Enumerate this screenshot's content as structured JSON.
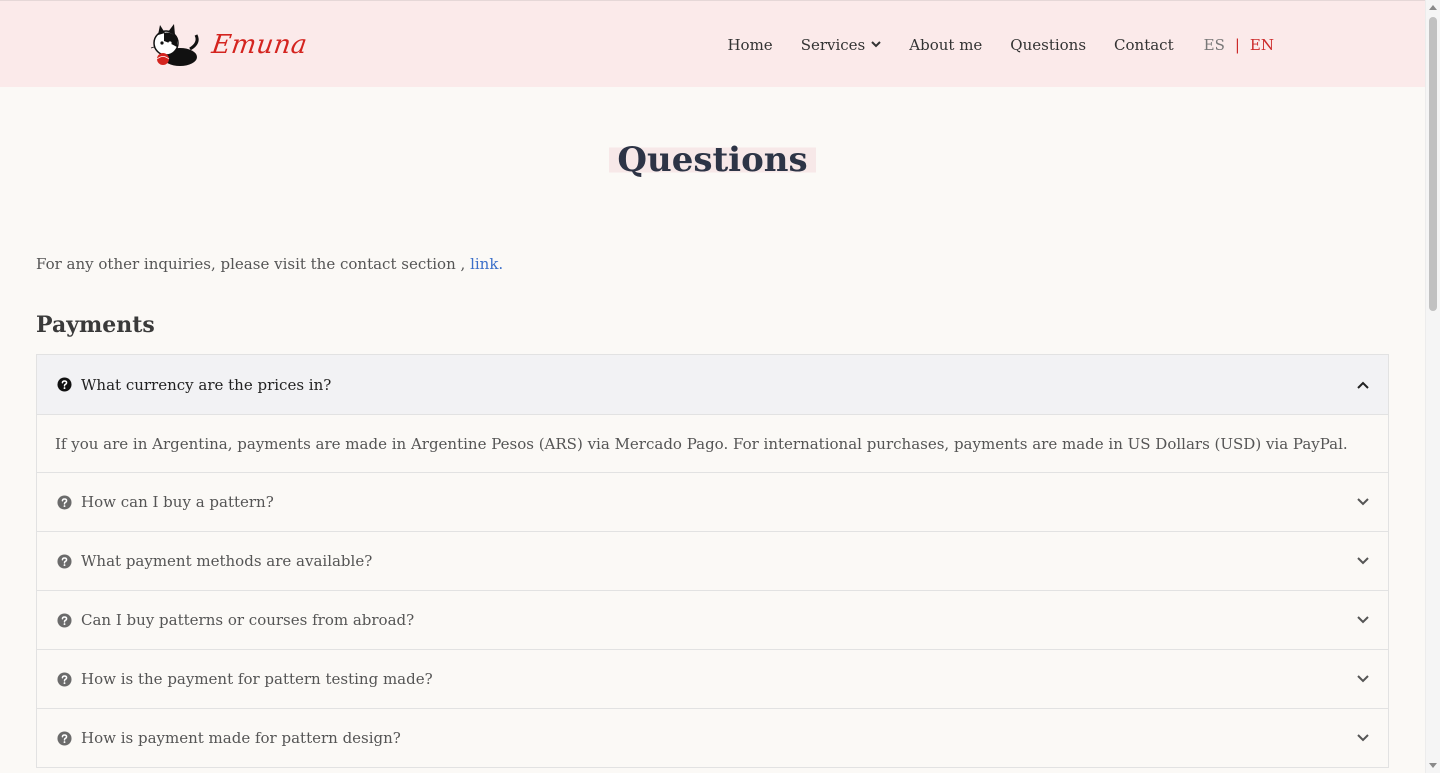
{
  "header": {
    "logo_text": "Emuna",
    "nav": [
      {
        "label": "Home"
      },
      {
        "label": "Services",
        "has_dropdown": true
      },
      {
        "label": "About me"
      },
      {
        "label": "Questions"
      },
      {
        "label": "Contact"
      }
    ],
    "lang": {
      "es": "ES",
      "separator": "|",
      "en": "EN",
      "active": "EN"
    }
  },
  "main": {
    "title": "Questions",
    "intro_text": "For any other inquiries, please visit the contact section , ",
    "intro_link": "link.",
    "section_title": "Payments",
    "faq": [
      {
        "question": "What currency are the prices in?",
        "open": true,
        "answer": "If you are in Argentina, payments are made in Argentine Pesos (ARS) via Mercado Pago. For international purchases, payments are made in US Dollars (USD) via PayPal."
      },
      {
        "question": "How can I buy a pattern?",
        "open": false
      },
      {
        "question": "What payment methods are available?",
        "open": false
      },
      {
        "question": "Can I buy patterns or courses from abroad?",
        "open": false
      },
      {
        "question": "How is the payment for pattern testing made?",
        "open": false
      },
      {
        "question": "How is payment made for pattern design?",
        "open": false
      }
    ]
  },
  "colors": {
    "header_bg": "#fbeaea",
    "page_bg": "#fbf9f6",
    "brand_red": "#d4241f",
    "link_blue": "#3b6fc9",
    "title_color": "#2d3446"
  },
  "icons": {
    "question": "question-circle-icon",
    "chevron_down": "chevron-down-icon",
    "chevron_up": "chevron-up-icon"
  }
}
